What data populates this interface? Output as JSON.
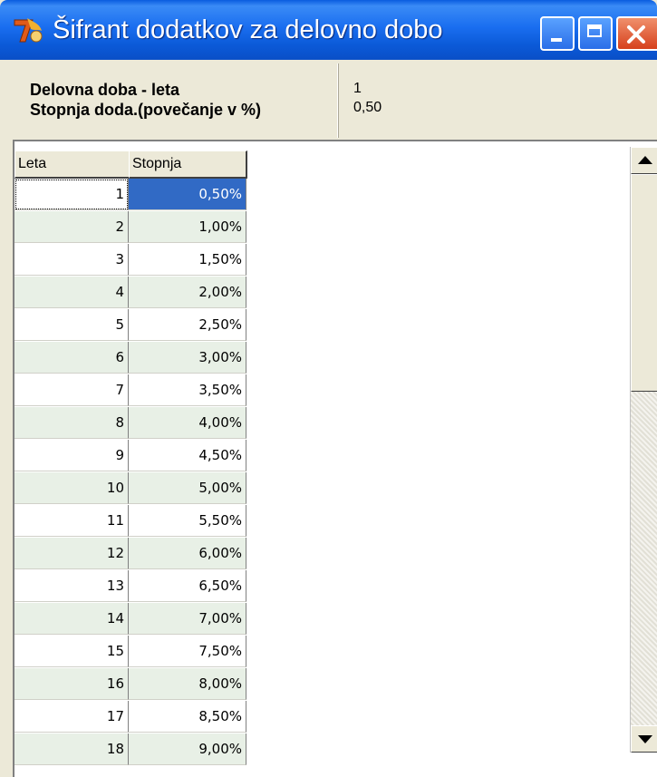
{
  "window": {
    "title": "Šifrant dodatkov za delovno dobo",
    "icon": "app-logo-icon"
  },
  "info_panel": {
    "label_years": "Delovna doba - leta",
    "label_rate": "Stopnja doda.(povečanje v %)",
    "value_years": "1",
    "value_rate": "0,50"
  },
  "grid": {
    "columns": [
      "Leta",
      "Stopnja"
    ],
    "rows": [
      {
        "leta": "1",
        "stopnja": "0,50%"
      },
      {
        "leta": "2",
        "stopnja": "1,00%"
      },
      {
        "leta": "3",
        "stopnja": "1,50%"
      },
      {
        "leta": "4",
        "stopnja": "2,00%"
      },
      {
        "leta": "5",
        "stopnja": "2,50%"
      },
      {
        "leta": "6",
        "stopnja": "3,00%"
      },
      {
        "leta": "7",
        "stopnja": "3,50%"
      },
      {
        "leta": "8",
        "stopnja": "4,00%"
      },
      {
        "leta": "9",
        "stopnja": "4,50%"
      },
      {
        "leta": "10",
        "stopnja": "5,00%"
      },
      {
        "leta": "11",
        "stopnja": "5,50%"
      },
      {
        "leta": "12",
        "stopnja": "6,00%"
      },
      {
        "leta": "13",
        "stopnja": "6,50%"
      },
      {
        "leta": "14",
        "stopnja": "7,00%"
      },
      {
        "leta": "15",
        "stopnja": "7,50%"
      },
      {
        "leta": "16",
        "stopnja": "8,00%"
      },
      {
        "leta": "17",
        "stopnja": "8,50%"
      },
      {
        "leta": "18",
        "stopnja": "9,00%"
      }
    ],
    "selected_row": 0
  },
  "colors": {
    "titlebar": "#0a5ddf",
    "selection": "#316ac5",
    "alt_row": "#e8f0e6",
    "close_button": "#d6401c"
  }
}
